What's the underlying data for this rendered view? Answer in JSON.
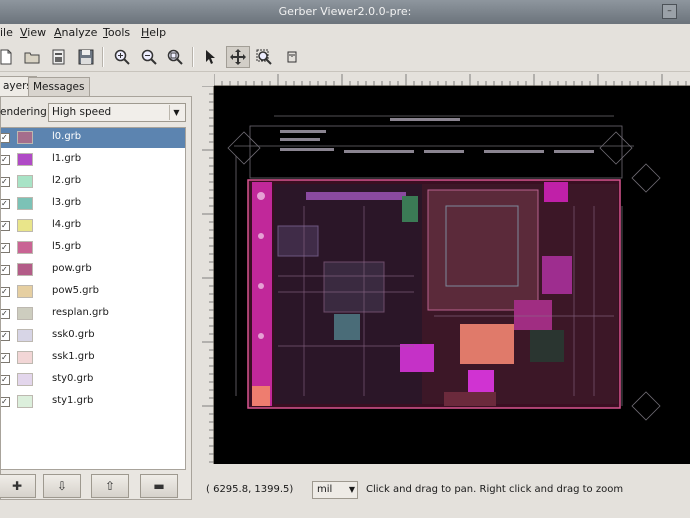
{
  "window": {
    "title": "Gerber Viewer2.0.0-pre:"
  },
  "menu": [
    {
      "label": "ile"
    },
    {
      "label": "View"
    },
    {
      "label": "Analyze"
    },
    {
      "label": "Tools"
    },
    {
      "label": "Help"
    }
  ],
  "toolbar": {
    "icons": [
      "new-file-icon",
      "open-folder-icon",
      "project-icon",
      "save-icon",
      "zoom-in-icon",
      "zoom-out-icon",
      "zoom-fit-icon",
      "pointer-icon",
      "pan-icon",
      "zoom-region-icon",
      "measure-icon"
    ]
  },
  "tabs": [
    {
      "label": "ayers"
    },
    {
      "label": "Messages"
    }
  ],
  "rendering": {
    "label": "endering",
    "value": "High speed"
  },
  "layers": [
    {
      "name": "l0.grb",
      "color": "#a56d8c",
      "checked": true,
      "selected": true
    },
    {
      "name": "l1.grb",
      "color": "#b04ac6",
      "checked": true,
      "selected": false
    },
    {
      "name": "l2.grb",
      "color": "#a8e3c6",
      "checked": true,
      "selected": false
    },
    {
      "name": "l3.grb",
      "color": "#7cc2b6",
      "checked": true,
      "selected": false
    },
    {
      "name": "l4.grb",
      "color": "#e9e58a",
      "checked": true,
      "selected": false
    },
    {
      "name": "l5.grb",
      "color": "#c96494",
      "checked": true,
      "selected": false
    },
    {
      "name": "pow.grb",
      "color": "#b35c88",
      "checked": true,
      "selected": false
    },
    {
      "name": "pow5.grb",
      "color": "#e6cfa1",
      "checked": true,
      "selected": false
    },
    {
      "name": "resplan.grb",
      "color": "#cdcdbf",
      "checked": true,
      "selected": false
    },
    {
      "name": "ssk0.grb",
      "color": "#d7d5e6",
      "checked": true,
      "selected": false
    },
    {
      "name": "ssk1.grb",
      "color": "#f2d6d6",
      "checked": true,
      "selected": false
    },
    {
      "name": "sty0.grb",
      "color": "#e3d6ec",
      "checked": true,
      "selected": false
    },
    {
      "name": "sty1.grb",
      "color": "#dcefdc",
      "checked": true,
      "selected": false
    }
  ],
  "layer_buttons": [
    "✚",
    "⇩",
    "⇧",
    "▬"
  ],
  "status": {
    "coords": "( 6295.8,    1399.5)",
    "unit": "mil",
    "hint": "Click and drag to pan. Right click and drag to zoom"
  }
}
